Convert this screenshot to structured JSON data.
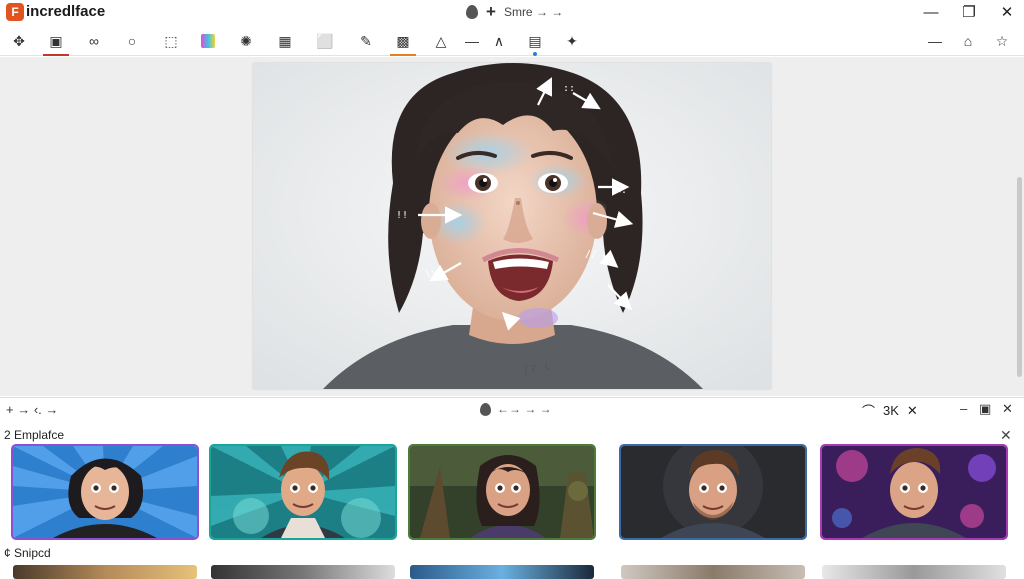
{
  "app": {
    "name": "incredlface",
    "logo_letter": "F",
    "title_center_text": "Smre → →"
  },
  "window_controls": {
    "minimize": "—",
    "restore": "❐",
    "close": "✕"
  },
  "toolbar": {
    "tools": [
      {
        "name": "puzzle-icon",
        "glyph": "✥"
      },
      {
        "name": "face-frame-icon",
        "glyph": "▣"
      },
      {
        "name": "link-icon",
        "glyph": "∞"
      },
      {
        "name": "lasso-icon",
        "glyph": "○"
      },
      {
        "name": "crop-icon",
        "glyph": "⬚"
      },
      {
        "name": "color-swatch-icon",
        "glyph": ""
      },
      {
        "name": "sparkle-icon",
        "glyph": "✺"
      },
      {
        "name": "grid-edit-icon",
        "glyph": "▦"
      },
      {
        "name": "select-icon",
        "glyph": "⬜"
      },
      {
        "name": "brush-icon",
        "glyph": "✎"
      },
      {
        "name": "layers-icon",
        "glyph": "▩"
      },
      {
        "name": "pen-icon",
        "glyph": "△"
      },
      {
        "name": "minus-icon",
        "glyph": "—"
      },
      {
        "name": "caret-up-icon",
        "glyph": "∧"
      },
      {
        "name": "calendar-icon",
        "glyph": "▤"
      },
      {
        "name": "plugin-icon",
        "glyph": "✦"
      }
    ],
    "right_tools": [
      {
        "name": "collapse-icon",
        "glyph": "—"
      },
      {
        "name": "home-icon",
        "glyph": "⌂"
      },
      {
        "name": "star-icon",
        "glyph": "☆"
      }
    ]
  },
  "canvas": {
    "photo_label": "[? └"
  },
  "panel_bar": {
    "left_controls": "+ → ‹. →",
    "center_text": "←→ → →",
    "wifi_label": "⌒",
    "count_label": "3K",
    "close": "✕",
    "minimize": "–",
    "maximize": "▣",
    "panel_close": "✕"
  },
  "sections": {
    "templates_title": "2 Emplafce",
    "templates_close": "✕",
    "snipped_title": "¢ Snipcd"
  },
  "colors": {
    "brand": "#e2531f",
    "toolbar_active": "#c0392b",
    "toolbar_active_alt": "#e67e22",
    "toolbar_dot": "#2a7fd4"
  },
  "thumbnails": [
    {
      "name": "thumbnail-teen-boy-blue-rays",
      "style": "sel-purple"
    },
    {
      "name": "thumbnail-boy-teal-burst",
      "style": "sel-teal"
    },
    {
      "name": "thumbnail-girl-forest",
      "style": "sel-green"
    },
    {
      "name": "thumbnail-man-dark",
      "style": "sel-blue"
    },
    {
      "name": "thumbnail-man-galaxy",
      "style": "sel-pink"
    }
  ]
}
